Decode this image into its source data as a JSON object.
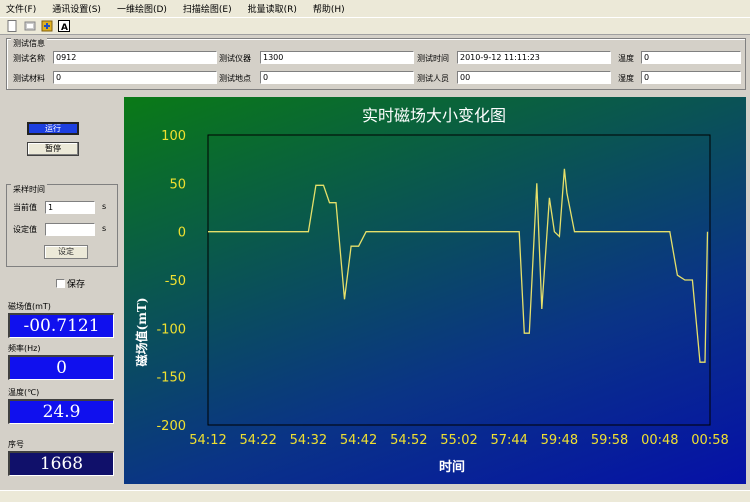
{
  "menu": [
    "文件(F)",
    "通讯设置(S)",
    "一维绘图(D)",
    "扫描绘图(E)",
    "批量读取(R)",
    "帮助(H)"
  ],
  "toolbar_icons": [
    "new-file-icon",
    "open-file-icon",
    "settings-icon",
    "about-icon"
  ],
  "test_info": {
    "title": "测试信息",
    "row1": [
      {
        "label": "测试名称",
        "value": "0912"
      },
      {
        "label": "测试仪器",
        "value": "1300"
      },
      {
        "label": "测试时间",
        "value": "2010-9-12 11:11:23"
      },
      {
        "label": "温度",
        "value": "0"
      }
    ],
    "row2": [
      {
        "label": "测试材料",
        "value": "0"
      },
      {
        "label": "测试地点",
        "value": "0"
      },
      {
        "label": "测试人员",
        "value": "00"
      },
      {
        "label": "湿度",
        "value": "0"
      }
    ]
  },
  "controls": {
    "start_label": "运行",
    "pause_label": "暂停"
  },
  "sampling": {
    "title": "采样时间",
    "current_label": "当前值",
    "current_value": "1",
    "current_unit": "s",
    "setting_label": "设定值",
    "setting_value": "",
    "setting_unit": "s",
    "set_button": "设定"
  },
  "save_label": "保存",
  "readouts": {
    "field": {
      "label": "磁场值(mT)",
      "value": "-00.7121"
    },
    "frequency": {
      "label": "频率(Hz)",
      "value": "0"
    },
    "temperature": {
      "label": "温度(℃)",
      "value": "24.9"
    },
    "serial": {
      "label": "序号",
      "value": "1668"
    }
  },
  "chart_data": {
    "type": "line",
    "title": "实时磁场大小变化图",
    "xlabel": "时间",
    "ylabel": "磁场值(mT)",
    "ylim": [
      -200,
      100
    ],
    "yticks": [
      100,
      50,
      0,
      -50,
      -100,
      -150,
      -200
    ],
    "xticks": [
      "54:12",
      "54:22",
      "54:32",
      "54:42",
      "54:52",
      "55:02",
      "57:44",
      "59:48",
      "59:58",
      "00:48",
      "00:58"
    ],
    "grid": false,
    "line_color": "#e6e06a",
    "x": [
      0,
      1,
      1.7,
      2.0,
      2.15,
      2.3,
      2.42,
      2.55,
      2.72,
      2.85,
      3.0,
      3.15,
      3.3,
      5.0,
      6.2,
      6.3,
      6.4,
      6.55,
      6.65,
      6.8,
      6.9,
      7.0,
      7.1,
      7.15,
      7.3,
      7.4,
      9.2,
      9.35,
      9.5,
      9.65,
      9.8,
      9.9,
      9.95
    ],
    "series": [
      {
        "values": [
          0,
          0,
          0,
          0,
          48,
          48,
          30,
          30,
          -70,
          -15,
          -15,
          0,
          0,
          0,
          0,
          -105,
          -105,
          50,
          -80,
          35,
          0,
          -5,
          65,
          40,
          0,
          0,
          0,
          -45,
          -50,
          -50,
          -135,
          -135,
          0
        ]
      }
    ]
  }
}
